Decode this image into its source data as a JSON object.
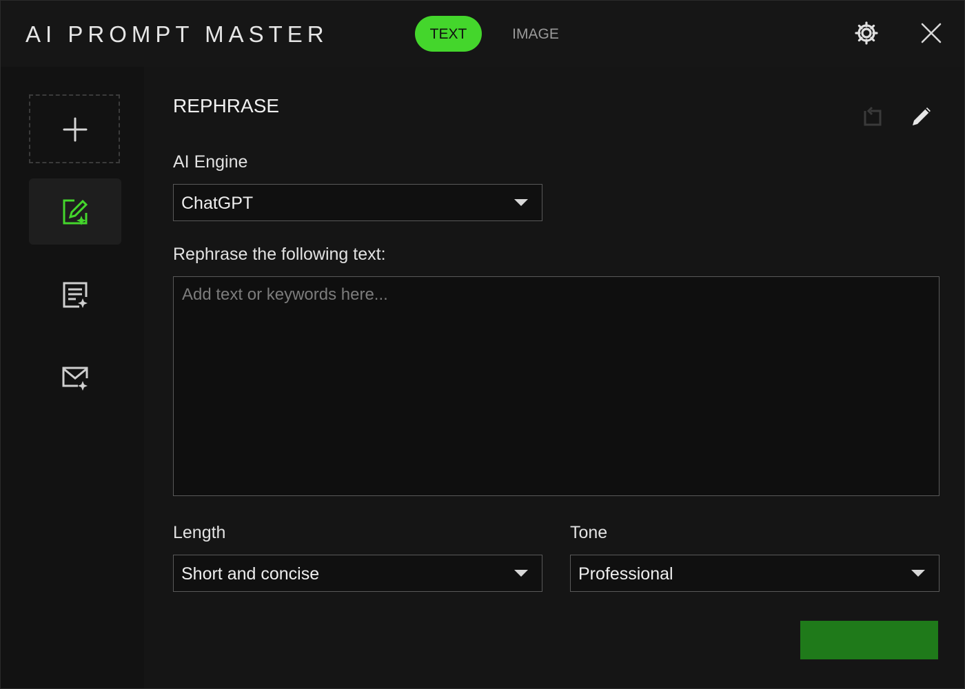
{
  "app": {
    "title": "AI PROMPT MASTER",
    "accent_color": "#44d62c"
  },
  "mode_tabs": [
    {
      "label": "TEXT",
      "active": true
    },
    {
      "label": "IMAGE",
      "active": false
    }
  ],
  "titlebar_icons": {
    "settings": "gear-icon",
    "close": "close-icon"
  },
  "sidebar": {
    "items": [
      {
        "name": "add-prompt",
        "icon": "plus-icon",
        "active": false
      },
      {
        "name": "rephrase",
        "icon": "edit-document-sparkle-icon",
        "active": true
      },
      {
        "name": "summarize",
        "icon": "document-lines-sparkle-icon",
        "active": false
      },
      {
        "name": "email",
        "icon": "mail-sparkle-icon",
        "active": false
      }
    ]
  },
  "main": {
    "section_title": "REPHRASE",
    "header_icons": {
      "reset": "reset-icon",
      "edit": "pencil-icon"
    },
    "engine": {
      "label": "AI Engine",
      "value": "ChatGPT"
    },
    "input": {
      "label": "Rephrase the following text:",
      "placeholder": "Add text or keywords here...",
      "value": ""
    },
    "length": {
      "label": "Length",
      "value": "Short and concise"
    },
    "tone": {
      "label": "Tone",
      "value": "Professional"
    },
    "submit": {
      "label": "",
      "color": "#1f7a1a"
    }
  }
}
